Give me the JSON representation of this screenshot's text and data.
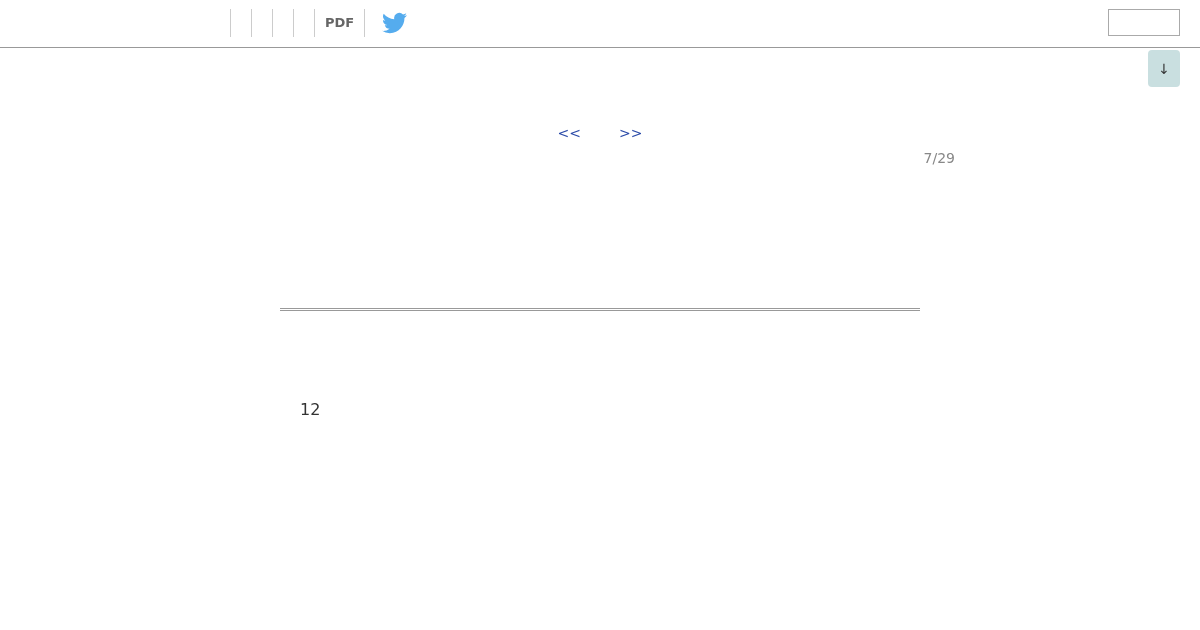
{
  "toolbar": {
    "pdf_link": "PDF"
  },
  "scroll_button": {
    "label": "↓"
  },
  "pager": {
    "prev": "<<",
    "next": ">>",
    "position": "7/29"
  },
  "page_number": "12"
}
